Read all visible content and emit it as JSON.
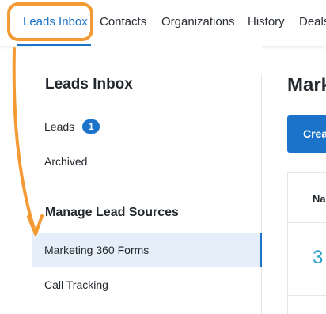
{
  "nav": {
    "tabs": [
      {
        "label": "Leads Inbox"
      },
      {
        "label": "Contacts"
      },
      {
        "label": "Organizations"
      },
      {
        "label": "History"
      },
      {
        "label": "Deals"
      }
    ]
  },
  "sidebar": {
    "title": "Leads Inbox",
    "items": [
      {
        "label": "Leads",
        "badge": "1"
      },
      {
        "label": "Archived"
      }
    ],
    "section_title": "Manage Lead Sources",
    "sources": [
      {
        "label": "Marketing 360 Forms"
      },
      {
        "label": "Call Tracking"
      }
    ]
  },
  "main": {
    "title": "Mark",
    "create_button": "Crea",
    "table_header": "Na",
    "row_glyph": "3"
  },
  "colors": {
    "accent": "#1a73c8",
    "annotation": "#f39a34",
    "selected_bg": "#e6eff9"
  }
}
